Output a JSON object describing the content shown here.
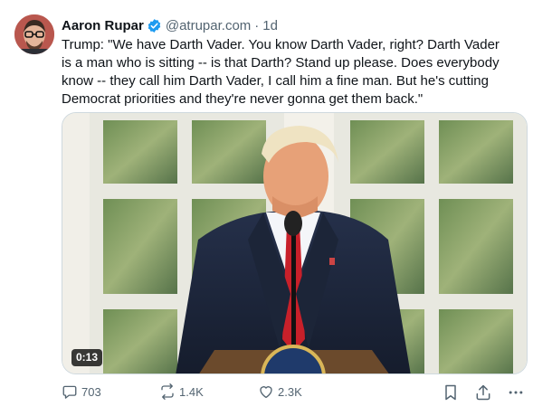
{
  "post": {
    "author_name": "Aaron Rupar",
    "handle": "@atrupar.com",
    "separator": "·",
    "time": "1d",
    "text": "Trump: \"We have Darth Vader. You know Darth Vader, right? Darth Vader\nis a man who is sitting -- is that Darth? Stand up please. Does everybody\nknow -- they call him Darth Vader, I call him a fine man. But he's cutting\nDemocrat priorities and they're never gonna get them back.\"",
    "avatar_icon": "avatar-icon",
    "verified_icon": "verified-badge-icon",
    "accent_color": "#1d9bf0"
  },
  "media": {
    "type": "video",
    "duration": "0:13"
  },
  "actions": {
    "reply_count": "703",
    "repost_count": "1.4K",
    "like_count": "2.3K",
    "reply_icon": "reply-icon",
    "repost_icon": "repost-icon",
    "like_icon": "heart-icon",
    "bookmark_icon": "bookmark-icon",
    "share_icon": "share-icon",
    "more_icon": "more-icon"
  }
}
